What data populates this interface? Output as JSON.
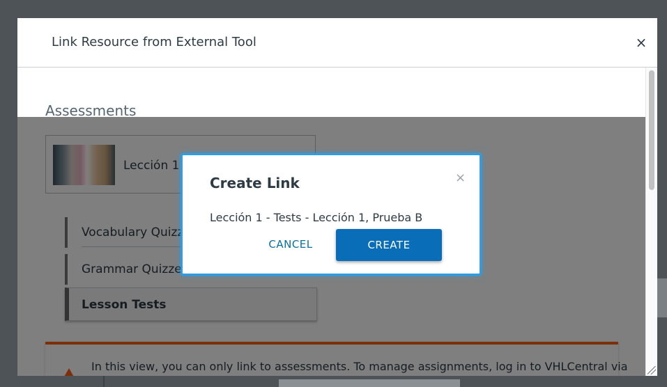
{
  "modal": {
    "title": "Link Resource from External Tool",
    "close_glyph": "×"
  },
  "content": {
    "section_heading": "Assessments",
    "resource_card": {
      "label": "Lección 1",
      "image_alt": "students-photo"
    },
    "nav_items": [
      {
        "label": "Vocabulary Quizzes",
        "active": false
      },
      {
        "label": "Grammar Quizzes",
        "active": false
      },
      {
        "label": "Lesson Tests",
        "active": true
      }
    ],
    "notice": {
      "icon": "warning-icon",
      "text": "In this view, you can only link to assessments. To manage assignments, log in to VHLCentral via"
    }
  },
  "dialog": {
    "title": "Create Link",
    "close_glyph": "×",
    "text": "Lección 1 - Tests - Lección 1, Prueba B",
    "cancel_label": "CANCEL",
    "create_label": "CREATE"
  },
  "colors": {
    "accent": "#0a6db7",
    "focus_ring": "#2b9ee8",
    "warning": "#fc5e13",
    "text": "#2d3b45"
  }
}
